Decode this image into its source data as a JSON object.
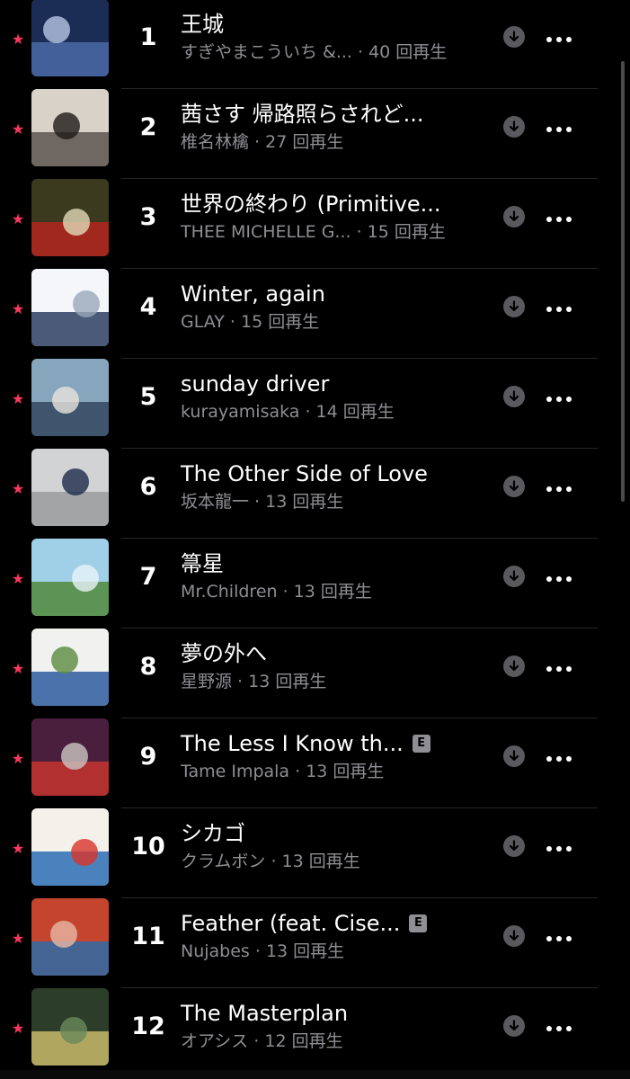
{
  "tracks": [
    {
      "rank": "1",
      "title": "王城",
      "subtitle": "すぎやまこういち &... · 40 回再生",
      "explicit": false,
      "favorite": true,
      "art": [
        "#1c2d55",
        "#4b6aa8",
        "#b8c6e3"
      ]
    },
    {
      "rank": "2",
      "title": "茜さす 帰路照らされど...",
      "subtitle": "椎名林檎 · 27 回再生",
      "explicit": false,
      "favorite": true,
      "art": [
        "#d8d2c8",
        "#5d5650",
        "#1f1a18"
      ]
    },
    {
      "rank": "3",
      "title": "世界の終わり (Primitive...",
      "subtitle": "THEE MICHELLE G... · 15 回再生",
      "explicit": false,
      "favorite": true,
      "art": [
        "#3b3a1e",
        "#b3261e",
        "#e2d9b8"
      ]
    },
    {
      "rank": "4",
      "title": "Winter, again",
      "subtitle": "GLAY · 15 回再生",
      "explicit": false,
      "favorite": true,
      "art": [
        "#f4f6fa",
        "#2c3e60",
        "#9aa7bc"
      ]
    },
    {
      "rank": "5",
      "title": "sunday driver",
      "subtitle": "kurayamisaka · 14 回再生",
      "explicit": false,
      "favorite": true,
      "art": [
        "#86a6bd",
        "#324760",
        "#e8e4dc"
      ]
    },
    {
      "rank": "6",
      "title": "The Other Side of Love",
      "subtitle": "坂本龍一 · 13 回再生",
      "explicit": false,
      "favorite": true,
      "art": [
        "#d2d3d4",
        "#9a9b9c",
        "#1d2a4a"
      ]
    },
    {
      "rank": "7",
      "title": "箒星",
      "subtitle": "Mr.Children · 13 回再生",
      "explicit": false,
      "favorite": true,
      "art": [
        "#9fd0e8",
        "#4f8a3a",
        "#e9f3f7"
      ]
    },
    {
      "rank": "8",
      "title": "夢の外へ",
      "subtitle": "星野源 · 13 回再生",
      "explicit": false,
      "favorite": true,
      "art": [
        "#f1f1ef",
        "#2e5c9e",
        "#5b8c3f"
      ]
    },
    {
      "rank": "9",
      "title": "The Less I Know th...",
      "subtitle": "Tame Impala · 13 回再生",
      "explicit": true,
      "favorite": true,
      "art": [
        "#4a1f3e",
        "#c4342d",
        "#c9c6c2"
      ]
    },
    {
      "rank": "10",
      "title": "シカゴ",
      "subtitle": "クラムボン · 13 回再生",
      "explicit": false,
      "favorite": true,
      "art": [
        "#f4f1ea",
        "#2b6fb6",
        "#d8352a"
      ]
    },
    {
      "rank": "11",
      "title": "Feather (feat. Cise...",
      "subtitle": "Nujabes · 13 回再生",
      "explicit": true,
      "favorite": true,
      "art": [
        "#c4442e",
        "#2e6aa6",
        "#e7b8a4"
      ]
    },
    {
      "rank": "12",
      "title": "The Masterplan",
      "subtitle": "オアシス · 12 回再生",
      "explicit": false,
      "favorite": true,
      "art": [
        "#2c3e2a",
        "#c8b86a",
        "#6c8a5a"
      ]
    }
  ],
  "labels": {
    "explicit_badge": "E",
    "favorite_glyph": "★"
  },
  "colors": {
    "background": "#000000",
    "favorite_star": "#ff375f",
    "secondary_text": "#8e8e93",
    "download_button": "#5a5a5e",
    "divider": "#262626"
  },
  "icons": {
    "download": "arrow-down-circle-icon",
    "more": "ellipsis-icon",
    "favorite": "star-icon",
    "explicit": "explicit-badge-icon"
  }
}
